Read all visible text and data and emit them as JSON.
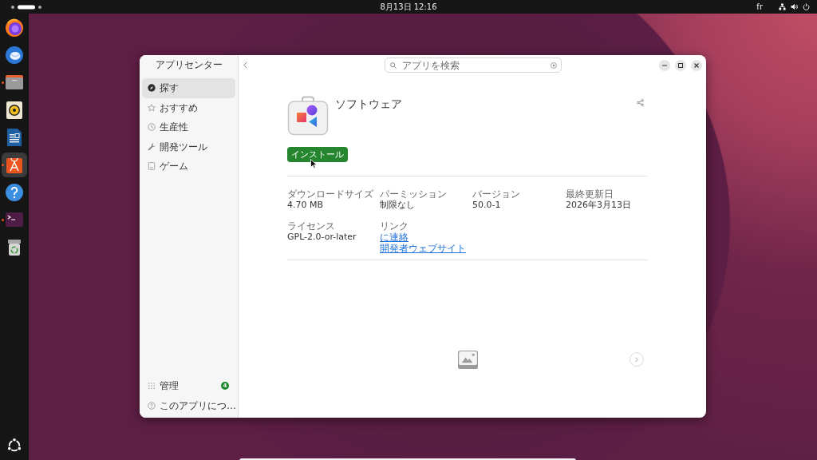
{
  "top_bar": {
    "date_time": "8月13日 12:16",
    "keyboard_layout": "fr"
  },
  "dock": {
    "apps": [
      {
        "kind": "browser",
        "running": false,
        "selected": false
      },
      {
        "kind": "mail",
        "running": false,
        "selected": false
      },
      {
        "kind": "files",
        "running": true,
        "selected": false
      },
      {
        "kind": "music",
        "running": false,
        "selected": false
      },
      {
        "kind": "document",
        "running": false,
        "selected": false
      },
      {
        "kind": "store",
        "running": true,
        "selected": true
      },
      {
        "kind": "help",
        "running": false,
        "selected": false
      },
      {
        "kind": "terminal",
        "running": true,
        "selected": false
      },
      {
        "kind": "trash",
        "running": false,
        "selected": false
      }
    ]
  },
  "window": {
    "sidebar": {
      "title": "アプリセンター",
      "items": [
        {
          "kind": "explore",
          "label": "探す",
          "selected": true
        },
        {
          "kind": "featured",
          "label": "おすすめ",
          "selected": false
        },
        {
          "kind": "productivity",
          "label": "生産性",
          "selected": false
        },
        {
          "kind": "developer",
          "label": "開発ツール",
          "selected": false
        },
        {
          "kind": "games",
          "label": "ゲーム",
          "selected": false
        }
      ],
      "footer_items": [
        {
          "kind": "manage",
          "label": "管理",
          "badge": "4"
        },
        {
          "kind": "about",
          "label": "このアプリにつ…"
        }
      ]
    },
    "search": {
      "placeholder": "アプリを検索"
    },
    "app": {
      "name": "ソフトウェア",
      "install_button": "インストール"
    },
    "details": [
      {
        "kind": "text",
        "label": "ダウンロードサイズ",
        "value": "4.70 MB"
      },
      {
        "kind": "text",
        "label": "パーミッション",
        "value": "制限なし"
      },
      {
        "kind": "text",
        "label": "バージョン",
        "value": "50.0-1"
      },
      {
        "kind": "text",
        "label": "最終更新日",
        "value": "2026年3月13日"
      },
      {
        "kind": "text",
        "label": "ライセンス",
        "value": "GPL-2.0-or-later"
      },
      {
        "kind": "links",
        "label": "リンク",
        "links": [
          "に連絡",
          "開発者ウェブサイト"
        ]
      }
    ]
  }
}
